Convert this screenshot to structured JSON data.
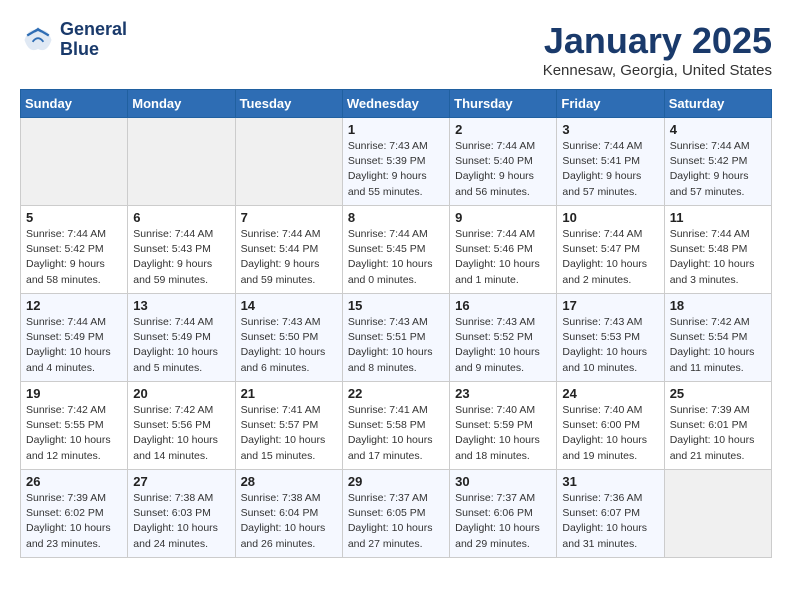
{
  "header": {
    "logo_line1": "General",
    "logo_line2": "Blue",
    "month": "January 2025",
    "location": "Kennesaw, Georgia, United States"
  },
  "weekdays": [
    "Sunday",
    "Monday",
    "Tuesday",
    "Wednesday",
    "Thursday",
    "Friday",
    "Saturday"
  ],
  "weeks": [
    [
      {
        "day": "",
        "info": ""
      },
      {
        "day": "",
        "info": ""
      },
      {
        "day": "",
        "info": ""
      },
      {
        "day": "1",
        "info": "Sunrise: 7:43 AM\nSunset: 5:39 PM\nDaylight: 9 hours\nand 55 minutes."
      },
      {
        "day": "2",
        "info": "Sunrise: 7:44 AM\nSunset: 5:40 PM\nDaylight: 9 hours\nand 56 minutes."
      },
      {
        "day": "3",
        "info": "Sunrise: 7:44 AM\nSunset: 5:41 PM\nDaylight: 9 hours\nand 57 minutes."
      },
      {
        "day": "4",
        "info": "Sunrise: 7:44 AM\nSunset: 5:42 PM\nDaylight: 9 hours\nand 57 minutes."
      }
    ],
    [
      {
        "day": "5",
        "info": "Sunrise: 7:44 AM\nSunset: 5:42 PM\nDaylight: 9 hours\nand 58 minutes."
      },
      {
        "day": "6",
        "info": "Sunrise: 7:44 AM\nSunset: 5:43 PM\nDaylight: 9 hours\nand 59 minutes."
      },
      {
        "day": "7",
        "info": "Sunrise: 7:44 AM\nSunset: 5:44 PM\nDaylight: 9 hours\nand 59 minutes."
      },
      {
        "day": "8",
        "info": "Sunrise: 7:44 AM\nSunset: 5:45 PM\nDaylight: 10 hours\nand 0 minutes."
      },
      {
        "day": "9",
        "info": "Sunrise: 7:44 AM\nSunset: 5:46 PM\nDaylight: 10 hours\nand 1 minute."
      },
      {
        "day": "10",
        "info": "Sunrise: 7:44 AM\nSunset: 5:47 PM\nDaylight: 10 hours\nand 2 minutes."
      },
      {
        "day": "11",
        "info": "Sunrise: 7:44 AM\nSunset: 5:48 PM\nDaylight: 10 hours\nand 3 minutes."
      }
    ],
    [
      {
        "day": "12",
        "info": "Sunrise: 7:44 AM\nSunset: 5:49 PM\nDaylight: 10 hours\nand 4 minutes."
      },
      {
        "day": "13",
        "info": "Sunrise: 7:44 AM\nSunset: 5:49 PM\nDaylight: 10 hours\nand 5 minutes."
      },
      {
        "day": "14",
        "info": "Sunrise: 7:43 AM\nSunset: 5:50 PM\nDaylight: 10 hours\nand 6 minutes."
      },
      {
        "day": "15",
        "info": "Sunrise: 7:43 AM\nSunset: 5:51 PM\nDaylight: 10 hours\nand 8 minutes."
      },
      {
        "day": "16",
        "info": "Sunrise: 7:43 AM\nSunset: 5:52 PM\nDaylight: 10 hours\nand 9 minutes."
      },
      {
        "day": "17",
        "info": "Sunrise: 7:43 AM\nSunset: 5:53 PM\nDaylight: 10 hours\nand 10 minutes."
      },
      {
        "day": "18",
        "info": "Sunrise: 7:42 AM\nSunset: 5:54 PM\nDaylight: 10 hours\nand 11 minutes."
      }
    ],
    [
      {
        "day": "19",
        "info": "Sunrise: 7:42 AM\nSunset: 5:55 PM\nDaylight: 10 hours\nand 12 minutes."
      },
      {
        "day": "20",
        "info": "Sunrise: 7:42 AM\nSunset: 5:56 PM\nDaylight: 10 hours\nand 14 minutes."
      },
      {
        "day": "21",
        "info": "Sunrise: 7:41 AM\nSunset: 5:57 PM\nDaylight: 10 hours\nand 15 minutes."
      },
      {
        "day": "22",
        "info": "Sunrise: 7:41 AM\nSunset: 5:58 PM\nDaylight: 10 hours\nand 17 minutes."
      },
      {
        "day": "23",
        "info": "Sunrise: 7:40 AM\nSunset: 5:59 PM\nDaylight: 10 hours\nand 18 minutes."
      },
      {
        "day": "24",
        "info": "Sunrise: 7:40 AM\nSunset: 6:00 PM\nDaylight: 10 hours\nand 19 minutes."
      },
      {
        "day": "25",
        "info": "Sunrise: 7:39 AM\nSunset: 6:01 PM\nDaylight: 10 hours\nand 21 minutes."
      }
    ],
    [
      {
        "day": "26",
        "info": "Sunrise: 7:39 AM\nSunset: 6:02 PM\nDaylight: 10 hours\nand 23 minutes."
      },
      {
        "day": "27",
        "info": "Sunrise: 7:38 AM\nSunset: 6:03 PM\nDaylight: 10 hours\nand 24 minutes."
      },
      {
        "day": "28",
        "info": "Sunrise: 7:38 AM\nSunset: 6:04 PM\nDaylight: 10 hours\nand 26 minutes."
      },
      {
        "day": "29",
        "info": "Sunrise: 7:37 AM\nSunset: 6:05 PM\nDaylight: 10 hours\nand 27 minutes."
      },
      {
        "day": "30",
        "info": "Sunrise: 7:37 AM\nSunset: 6:06 PM\nDaylight: 10 hours\nand 29 minutes."
      },
      {
        "day": "31",
        "info": "Sunrise: 7:36 AM\nSunset: 6:07 PM\nDaylight: 10 hours\nand 31 minutes."
      },
      {
        "day": "",
        "info": ""
      }
    ]
  ]
}
